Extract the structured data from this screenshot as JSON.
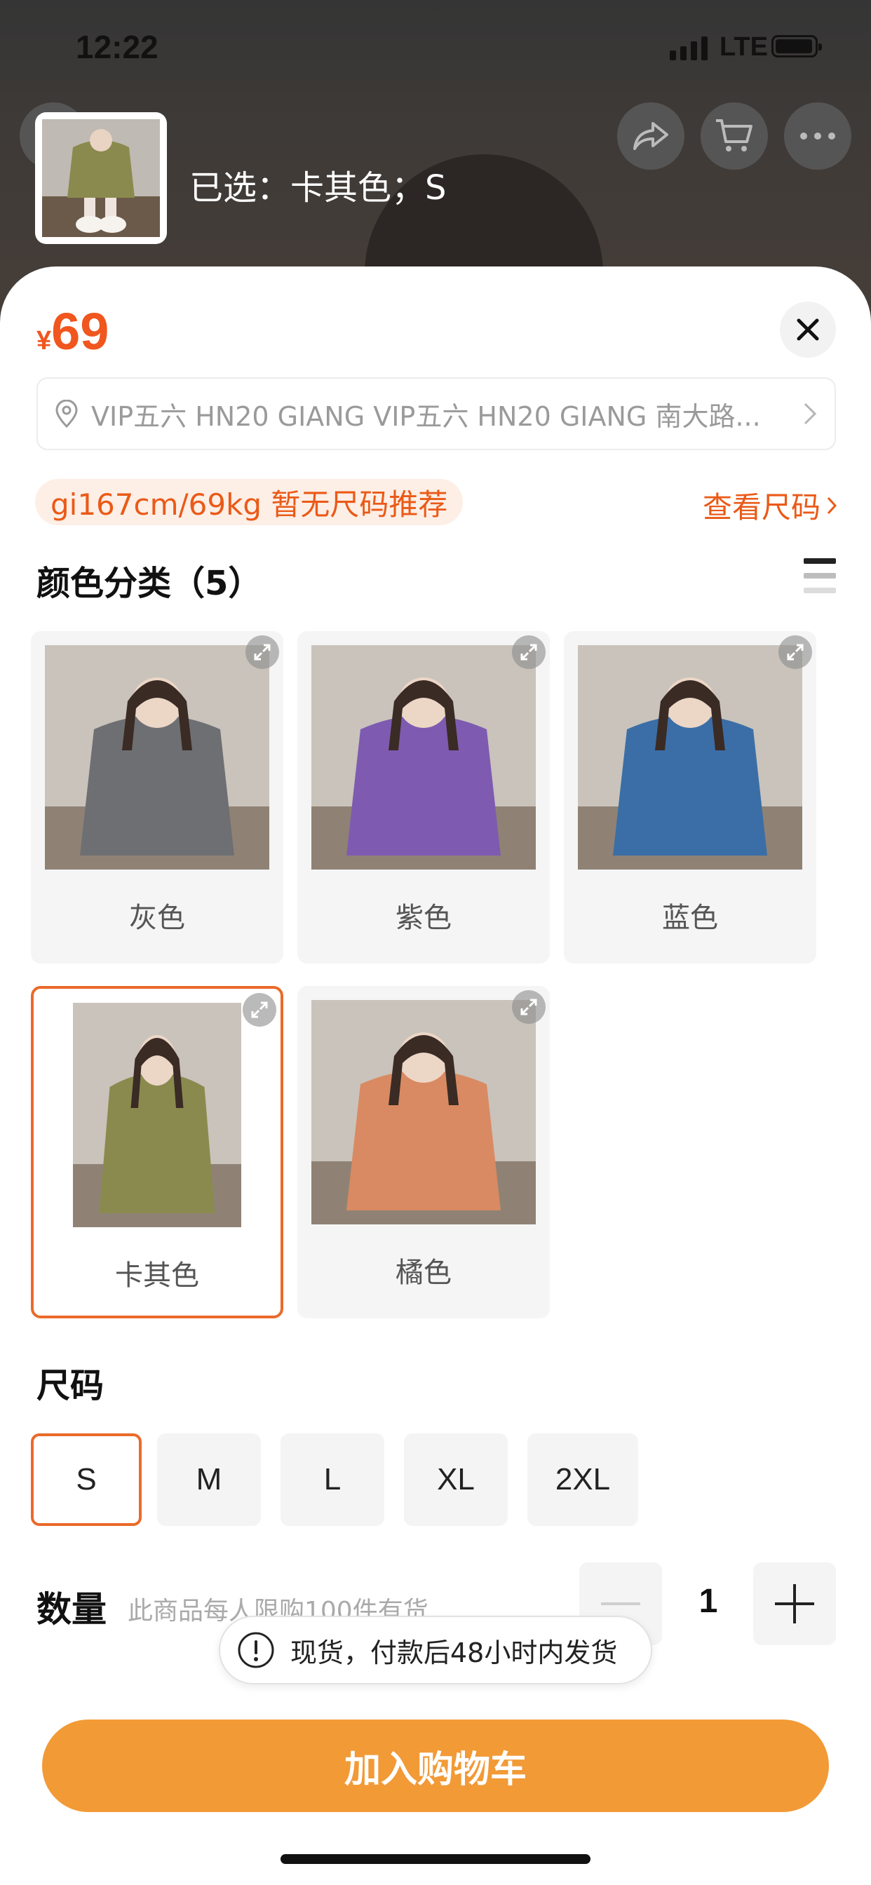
{
  "status_bar": {
    "time": "12:22",
    "network": "LTE"
  },
  "header": {
    "selected_text": "已选：卡其色；S",
    "icons": [
      "back-icon",
      "share-icon",
      "cart-icon",
      "more-icon"
    ]
  },
  "product": {
    "currency": "¥",
    "price": "69",
    "address": "VIP五六 HN20 GIANG VIP五六 HN20 GIANG 南大路...",
    "size_recommendation": "gi167cm/69kg 暂无尺码推荐",
    "size_chart_link": "查看尺码"
  },
  "colors": {
    "title": "颜色分类（5）",
    "items": [
      {
        "label": "灰色",
        "selected": false,
        "sweater_color": "#6e6f73"
      },
      {
        "label": "紫色",
        "selected": false,
        "sweater_color": "#7e5bb0"
      },
      {
        "label": "蓝色",
        "selected": false,
        "sweater_color": "#3b6ea6"
      },
      {
        "label": "卡其色",
        "selected": true,
        "sweater_color": "#8a8a4e"
      },
      {
        "label": "橘色",
        "selected": false,
        "sweater_color": "#d98a62"
      }
    ]
  },
  "sizes": {
    "title": "尺码",
    "options": [
      "S",
      "M",
      "L",
      "XL",
      "2XL"
    ],
    "selected": "S"
  },
  "quantity": {
    "label": "数量",
    "note": "此商品每人限购100件有货",
    "value": "1"
  },
  "toast": {
    "text": "现货，付款后48小时内发货"
  },
  "cta": {
    "label": "加入购物车"
  },
  "colors_theme": {
    "accent": "#ea5a18",
    "button": "#f29a36",
    "selected_border": "#ea6a2a"
  }
}
